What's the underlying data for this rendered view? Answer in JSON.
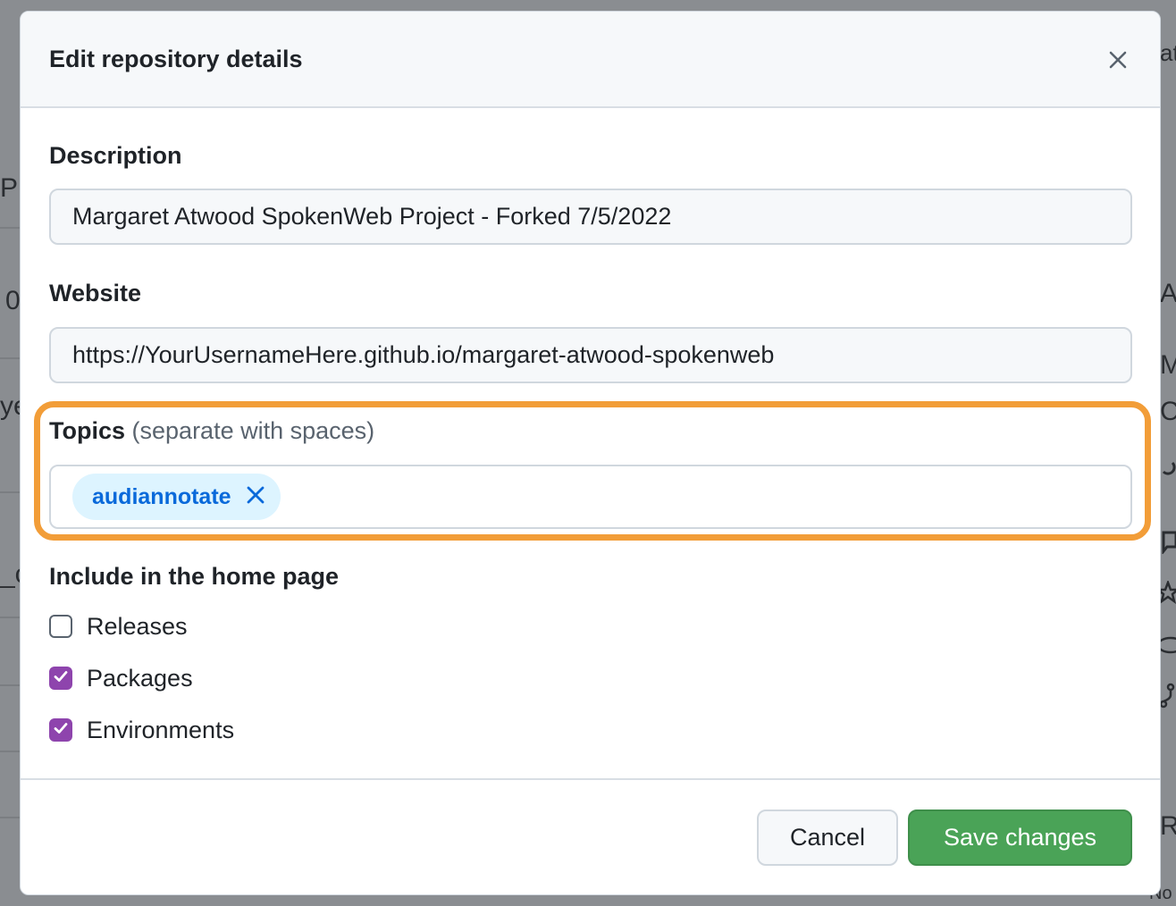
{
  "background": {
    "left_fragments": [
      "Pr",
      "0",
      "ye",
      "_c"
    ],
    "right_fragments": [
      "at",
      "Ab",
      "Ma",
      "Co",
      "Re",
      "No"
    ]
  },
  "dialog": {
    "title": "Edit repository details",
    "close_icon": "close-icon"
  },
  "description": {
    "label": "Description",
    "value": "Margaret Atwood SpokenWeb Project - Forked 7/5/2022"
  },
  "website": {
    "label": "Website",
    "value": "https://YourUsernameHere.github.io/margaret-atwood-spokenweb"
  },
  "topics": {
    "label": "Topics",
    "hint": "(separate with spaces)",
    "items": [
      {
        "label": "audiannotate"
      }
    ]
  },
  "home_page": {
    "title": "Include in the home page",
    "options": [
      {
        "label": "Releases",
        "checked": false
      },
      {
        "label": "Packages",
        "checked": true
      },
      {
        "label": "Environments",
        "checked": true
      }
    ]
  },
  "footer": {
    "cancel_label": "Cancel",
    "save_label": "Save changes"
  },
  "colors": {
    "highlight": "#f29d38",
    "checkbox_accent": "#8e44ad",
    "save_button": "#4aa357",
    "topic_chip_bg": "#ddf4ff",
    "topic_chip_text": "#0969da"
  }
}
